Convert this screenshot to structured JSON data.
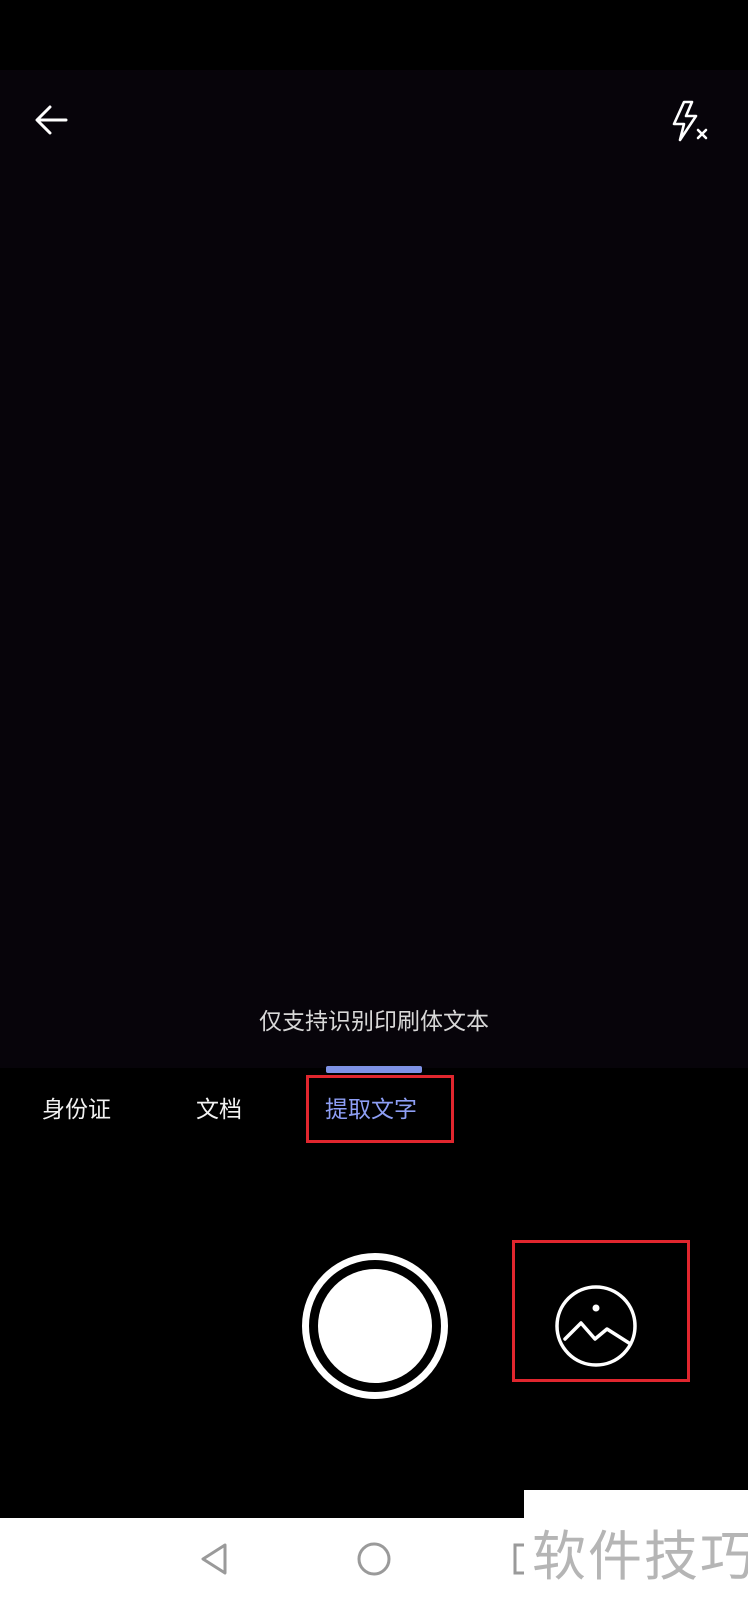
{
  "hint_text": "仅支持识别印刷体文本",
  "tabs": [
    {
      "label": "身份证",
      "selected": false
    },
    {
      "label": "文档",
      "selected": false
    },
    {
      "label": "提取文字",
      "selected": true
    }
  ],
  "icons": {
    "back": "arrow-left-icon",
    "flash": "flash-off-icon",
    "shutter": "shutter-icon",
    "gallery": "gallery-icon",
    "nav_back": "nav-back-icon",
    "nav_home": "nav-home-icon",
    "nav_recent": "nav-recent-icon"
  },
  "colors": {
    "accent": "#8d9ef4",
    "indicator": "#7f92e6",
    "highlight": "#e0262e",
    "background": "#000000"
  },
  "watermark": "软件技巧"
}
